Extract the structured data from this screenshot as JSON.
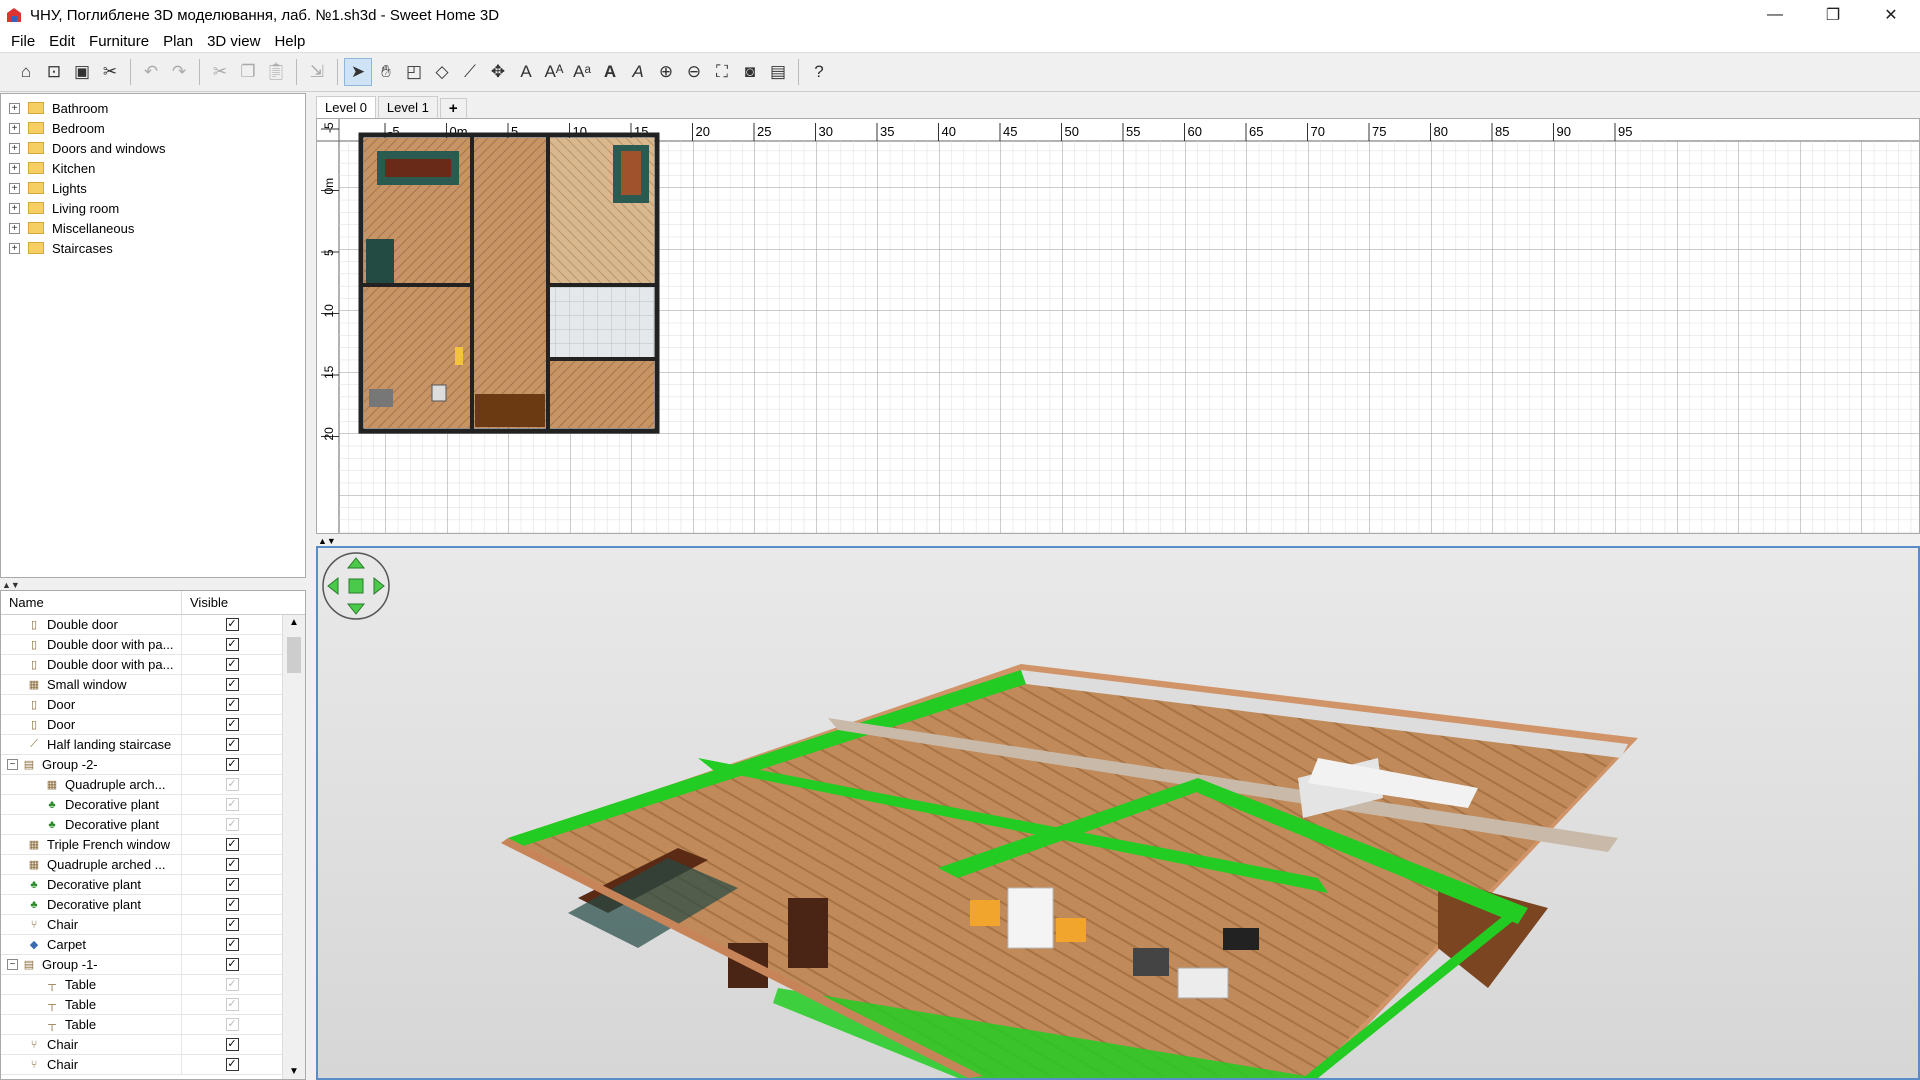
{
  "window": {
    "title": "ЧНУ, Поглиблене 3D моделювання, лаб. №1.sh3d - Sweet Home 3D",
    "minimize": "—",
    "restore": "❐",
    "close": "✕"
  },
  "menu": [
    "File",
    "Edit",
    "Furniture",
    "Plan",
    "3D view",
    "Help"
  ],
  "catalog": {
    "categories": [
      "Bathroom",
      "Bedroom",
      "Doors and windows",
      "Kitchen",
      "Lights",
      "Living room",
      "Miscellaneous",
      "Staircases"
    ]
  },
  "furniture_list": {
    "columns": [
      "Name",
      "Visible"
    ],
    "rows": [
      {
        "name": "Double door",
        "indent": 1,
        "visible": true,
        "enabled": true,
        "icon": "door-icon"
      },
      {
        "name": "Double door with pa...",
        "indent": 1,
        "visible": true,
        "enabled": true,
        "icon": "door-icon"
      },
      {
        "name": "Double door with pa...",
        "indent": 1,
        "visible": true,
        "enabled": true,
        "icon": "door-icon"
      },
      {
        "name": "Small window",
        "indent": 1,
        "visible": true,
        "enabled": true,
        "icon": "window-icon"
      },
      {
        "name": "Door",
        "indent": 1,
        "visible": true,
        "enabled": true,
        "icon": "door-icon"
      },
      {
        "name": "Door",
        "indent": 1,
        "visible": true,
        "enabled": true,
        "icon": "door-icon"
      },
      {
        "name": "Half landing staircase",
        "indent": 1,
        "visible": true,
        "enabled": true,
        "icon": "staircase-icon"
      },
      {
        "name": "Group -2-",
        "indent": 0,
        "visible": true,
        "enabled": true,
        "icon": "group-icon",
        "expander": "−"
      },
      {
        "name": "Quadruple arch...",
        "indent": 2,
        "visible": true,
        "enabled": false,
        "icon": "window-icon"
      },
      {
        "name": "Decorative plant",
        "indent": 2,
        "visible": true,
        "enabled": false,
        "icon": "plant-icon"
      },
      {
        "name": "Decorative plant",
        "indent": 2,
        "visible": true,
        "enabled": false,
        "icon": "plant-icon"
      },
      {
        "name": "Triple French window",
        "indent": 1,
        "visible": true,
        "enabled": true,
        "icon": "window-icon"
      },
      {
        "name": "Quadruple arched ...",
        "indent": 1,
        "visible": true,
        "enabled": true,
        "icon": "window-icon"
      },
      {
        "name": "Decorative plant",
        "indent": 1,
        "visible": true,
        "enabled": true,
        "icon": "plant-icon"
      },
      {
        "name": "Decorative plant",
        "indent": 1,
        "visible": true,
        "enabled": true,
        "icon": "plant-icon"
      },
      {
        "name": "Chair",
        "indent": 1,
        "visible": true,
        "enabled": true,
        "icon": "chair-icon"
      },
      {
        "name": "Carpet",
        "indent": 1,
        "visible": true,
        "enabled": true,
        "icon": "carpet-icon"
      },
      {
        "name": "Group -1-",
        "indent": 0,
        "visible": true,
        "enabled": true,
        "icon": "group-icon",
        "expander": "−"
      },
      {
        "name": "Table",
        "indent": 2,
        "visible": true,
        "enabled": false,
        "icon": "table-icon"
      },
      {
        "name": "Table",
        "indent": 2,
        "visible": true,
        "enabled": false,
        "icon": "table-icon"
      },
      {
        "name": "Table",
        "indent": 2,
        "visible": true,
        "enabled": false,
        "icon": "table-icon"
      },
      {
        "name": "Chair",
        "indent": 1,
        "visible": true,
        "enabled": true,
        "icon": "chair-icon"
      },
      {
        "name": "Chair",
        "indent": 1,
        "visible": true,
        "enabled": true,
        "icon": "chair-icon"
      }
    ]
  },
  "plan": {
    "levels": [
      "Level 0",
      "Level 1"
    ],
    "add_level": "+",
    "ruler_x": [
      "-5",
      "0m",
      "5",
      "10",
      "15",
      "20",
      "25",
      "30",
      "35",
      "40",
      "45",
      "50",
      "55",
      "60",
      "65",
      "70",
      "75",
      "80",
      "85",
      "90",
      "95"
    ],
    "ruler_y": [
      "-5",
      "0m",
      "5",
      "10",
      "15",
      "20"
    ]
  },
  "colors": {
    "wall_green": "#22cc22",
    "floor_wood": "#c08a5a",
    "wall_outer": "#d09468",
    "plan_grid": "#d9d9d9",
    "view_bg": "#e6e6e6",
    "selection_blue": "#5a8dc8"
  },
  "toolbar_icons": [
    "new-home-icon",
    "open-icon",
    "save-icon",
    "cut-icon",
    "undo-icon",
    "redo-icon",
    "cut-icon",
    "copy-icon",
    "paste-icon",
    "add-furniture-icon",
    "select-icon",
    "pan-icon",
    "create-walls-icon",
    "create-rooms-icon",
    "create-polylines-icon",
    "create-dimensions-icon",
    "add-text-icon",
    "increase-text-icon",
    "decrease-text-icon",
    "bold-text-icon",
    "italic-text-icon",
    "zoom-in-icon",
    "zoom-out-icon",
    "import-background-icon",
    "create-photo-icon",
    "create-video-icon",
    "help-icon"
  ]
}
